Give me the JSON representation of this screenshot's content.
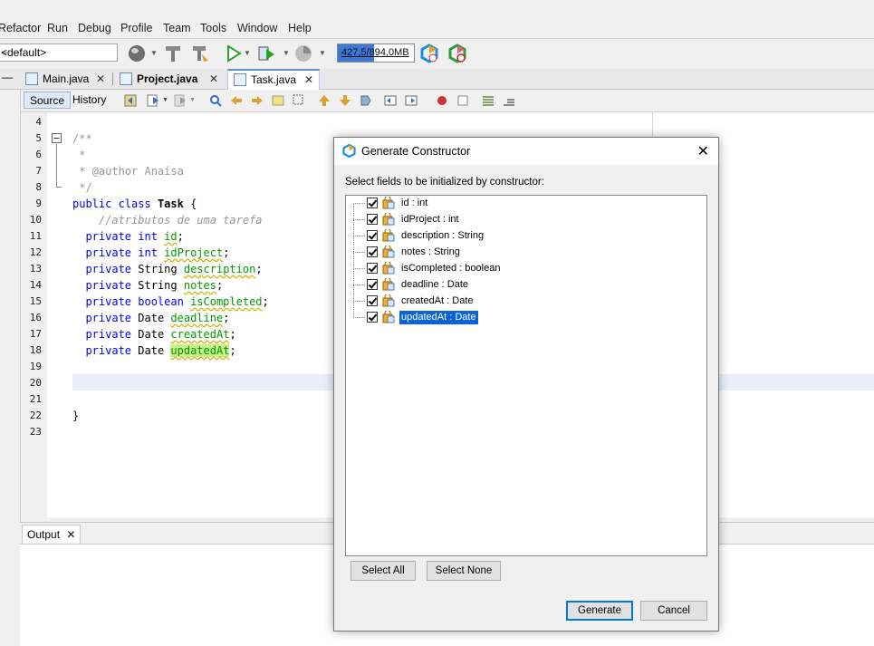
{
  "menu": [
    "Refactor",
    "Run",
    "Debug",
    "Profile",
    "Team",
    "Tools",
    "Window",
    "Help"
  ],
  "toolbar": {
    "config_selected": "<default>",
    "memory_text": "427,5/894,0MB",
    "memory_fraction": 0.478
  },
  "tabs": [
    {
      "label": "Main.java",
      "active": false
    },
    {
      "label": "Project.java",
      "active": false
    },
    {
      "label": "Task.java",
      "active": true
    }
  ],
  "editor_toolbar": {
    "source": "Source",
    "history": "History"
  },
  "line_numbers": [
    "4",
    "5",
    "6",
    "7",
    "8",
    "9",
    "10",
    "11",
    "12",
    "13",
    "14",
    "15",
    "16",
    "17",
    "18",
    "19",
    "20",
    "21",
    "22",
    "23"
  ],
  "code": {
    "l5": "/**",
    "l6": " *",
    "l7": " * @author Anaísa",
    "l8": " */",
    "l9_kw": "public class",
    "l9_name": "Task",
    "l9_brace": "{",
    "l10": "    //atributos de uma tarefa",
    "fields": [
      {
        "mods": "private int",
        "name": "id"
      },
      {
        "mods": "private int",
        "name": "idProject"
      },
      {
        "mods": "private",
        "type": "String",
        "name": "description"
      },
      {
        "mods": "private",
        "type": "String",
        "name": "notes"
      },
      {
        "mods": "private boolean",
        "name": "isCompleted"
      },
      {
        "mods": "private",
        "type": "Date",
        "name": "deadline"
      },
      {
        "mods": "private",
        "type": "Date",
        "name": "createdAt"
      },
      {
        "mods": "private",
        "type": "Date",
        "name": "updatedAt"
      }
    ],
    "l22": "}"
  },
  "output_tab": "Output",
  "dialog": {
    "title": "Generate Constructor",
    "label": "Select fields to be initialized by constructor:",
    "fields": [
      {
        "label": "id : int",
        "checked": true
      },
      {
        "label": "idProject : int",
        "checked": true
      },
      {
        "label": "description : String",
        "checked": true
      },
      {
        "label": "notes : String",
        "checked": true
      },
      {
        "label": "isCompleted : boolean",
        "checked": true
      },
      {
        "label": "deadline : Date",
        "checked": true
      },
      {
        "label": "createdAt : Date",
        "checked": true
      },
      {
        "label": "updatedAt : Date",
        "checked": true,
        "selected": true
      }
    ],
    "select_all": "Select All",
    "select_none": "Select None",
    "generate": "Generate",
    "cancel": "Cancel"
  }
}
